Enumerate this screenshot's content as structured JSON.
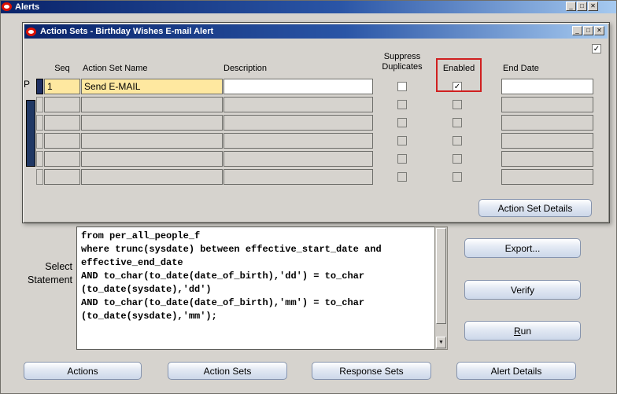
{
  "window": {
    "title": "Alerts",
    "minimize_glyph": "_",
    "maximize_glyph": "□",
    "close_glyph": "✕"
  },
  "dialog": {
    "title": "Action Sets - Birthday Wishes E-mail Alert",
    "check_glyph": "✓",
    "top_checkbox_checked": true,
    "columns": {
      "seq": "Seq",
      "name": "Action Set Name",
      "description": "Description",
      "suppress_line1": "Suppress",
      "suppress_line2": "Duplicates",
      "enabled": "Enabled",
      "end_date": "End Date"
    },
    "rows": [
      {
        "active": true,
        "seq": "1",
        "name": "Send E-MAIL",
        "description": "",
        "suppress": false,
        "enabled": true,
        "end_date": ""
      },
      {
        "active": false,
        "seq": "",
        "name": "",
        "description": "",
        "suppress": false,
        "enabled": false,
        "end_date": ""
      },
      {
        "active": false,
        "seq": "",
        "name": "",
        "description": "",
        "suppress": false,
        "enabled": false,
        "end_date": ""
      },
      {
        "active": false,
        "seq": "",
        "name": "",
        "description": "",
        "suppress": false,
        "enabled": false,
        "end_date": ""
      },
      {
        "active": false,
        "seq": "",
        "name": "",
        "description": "",
        "suppress": false,
        "enabled": false,
        "end_date": ""
      },
      {
        "active": false,
        "seq": "",
        "name": "",
        "description": "",
        "suppress": false,
        "enabled": false,
        "end_date": ""
      }
    ],
    "action_set_details_button": "Action Set Details"
  },
  "main": {
    "artifact_label": "P",
    "select_label_line1": "Select",
    "select_label_line2": "Statement",
    "sql_text": "from per_all_people_f\nwhere trunc(sysdate) between effective_start_date and\neffective_end_date\nAND to_char(to_date(date_of_birth),'dd') = to_char\n(to_date(sysdate),'dd')\nAND to_char(to_date(date_of_birth),'mm') = to_char\n(to_date(sysdate),'mm');",
    "scrollbar_down_glyph": "▼",
    "buttons": {
      "export": "Export...",
      "verify": "Verify",
      "run": "Run"
    },
    "bottom_buttons": [
      "Actions",
      "Action Sets",
      "Response Sets",
      "Alert Details"
    ]
  },
  "colors": {
    "titlebar_dark": "#0a246a",
    "titlebar_light": "#a6caf0",
    "highlight_field": "#fee8a0",
    "focus_red": "#d02020",
    "button_face": "#d9e2ef"
  }
}
